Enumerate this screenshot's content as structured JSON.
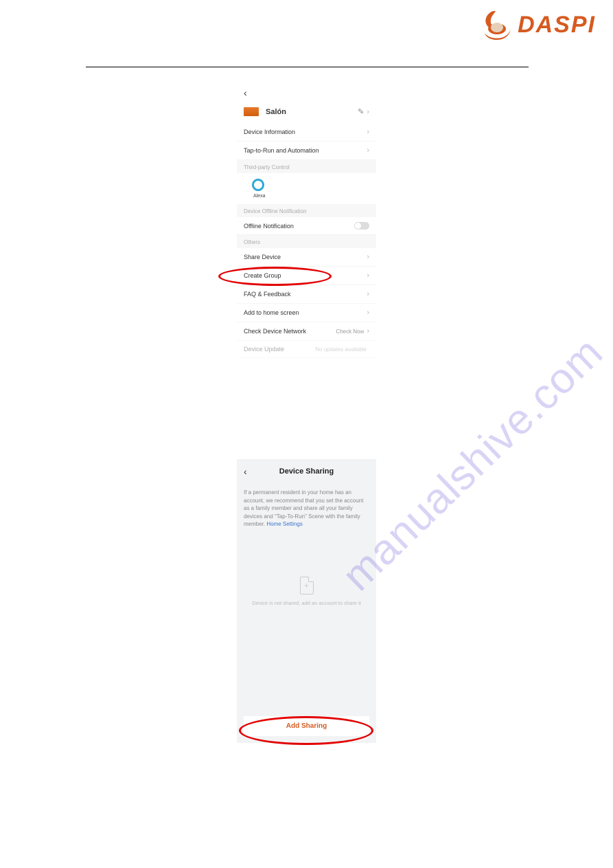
{
  "brand": {
    "name": "DASPI"
  },
  "screen1": {
    "device_name": "Salón",
    "rows": {
      "device_information": "Device Information",
      "tap_automation": "Tap-to-Run and Automation",
      "third_party_header": "Third-party Control",
      "alexa_label": "Alexa",
      "offline_header": "Device Offline Notification",
      "offline_notification": "Offline Notification",
      "others_header": "Others",
      "share_device": "Share Device",
      "create_group": "Create Group",
      "faq_feedback": "FAQ & Feedback",
      "add_home": "Add to home screen",
      "check_network": "Check Device Network",
      "check_now": "Check Now",
      "device_update": "Device Update",
      "no_updates": "No updates available"
    }
  },
  "screen2": {
    "title": "Device Sharing",
    "note": "If a permanent resident in your home has an account, we recommend that you set the account as a family member and share all your family devices and \"Tap-To-Run\" Scene with the family member.",
    "home_settings": "Home Settings",
    "empty_text": "Device is not shared, add an account to share it",
    "add_sharing": "Add Sharing"
  },
  "watermark": "manualshive.com"
}
